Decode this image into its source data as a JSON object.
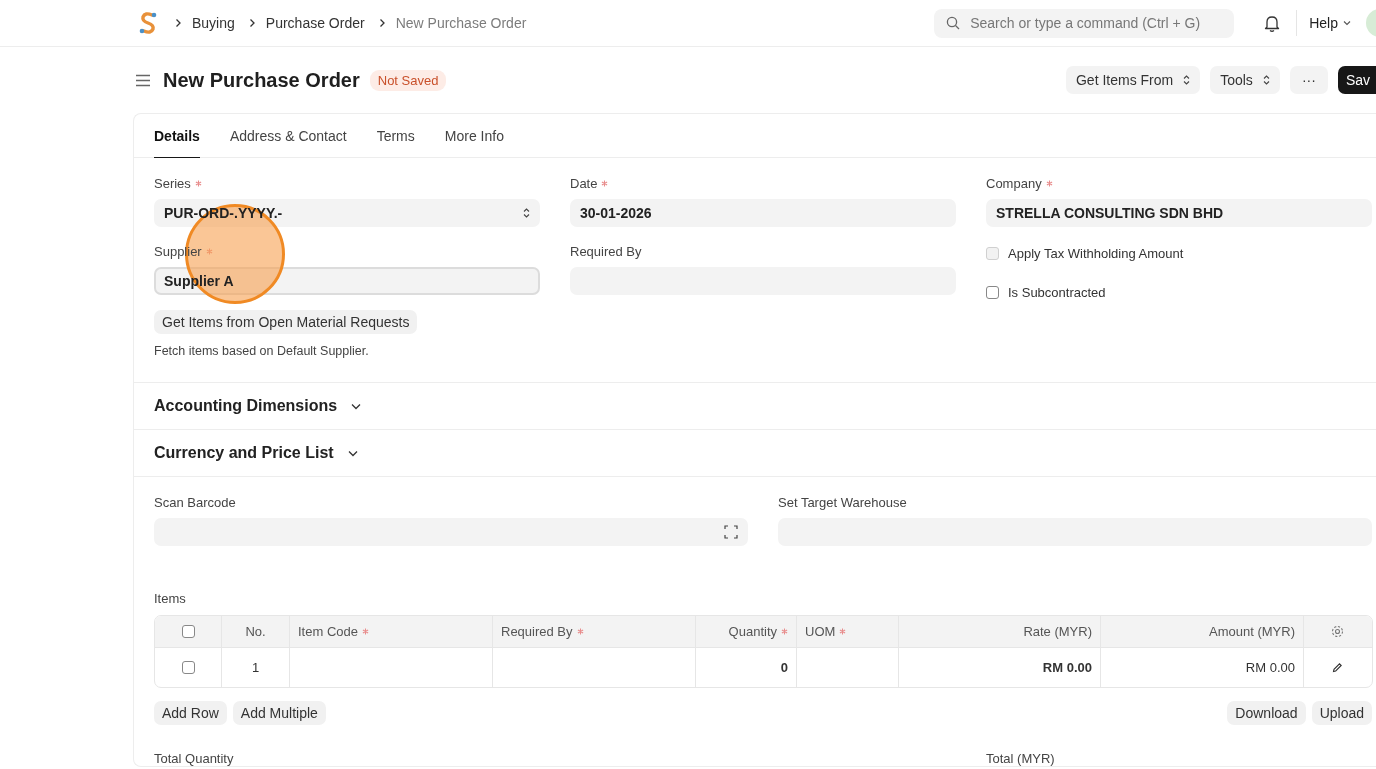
{
  "breadcrumbs": [
    {
      "label": "Buying",
      "current": false
    },
    {
      "label": "Purchase Order",
      "current": false
    },
    {
      "label": "New Purchase Order",
      "current": true
    }
  ],
  "search": {
    "placeholder": "Search or type a command (Ctrl + G)"
  },
  "help": "Help",
  "title": "New Purchase Order",
  "status": "Not Saved",
  "actions": [
    {
      "kind": "dropdown",
      "label": "Get Items From"
    },
    {
      "kind": "dropdown",
      "label": "Tools"
    },
    {
      "kind": "plain",
      "label": "···"
    },
    {
      "kind": "primary",
      "label": "Sav"
    }
  ],
  "tabs": [
    {
      "label": "Details",
      "selected": true
    },
    {
      "label": "Address & Contact",
      "selected": false
    },
    {
      "label": "Terms",
      "selected": false
    },
    {
      "label": "More Info",
      "selected": false
    }
  ],
  "columns": [
    [
      {
        "kind": "select",
        "label": "Series",
        "required": true,
        "value": "PUR-ORD-.YYYY.-",
        "focused": false
      },
      {
        "kind": "link",
        "label": "Supplier",
        "required": true,
        "value": "Supplier A",
        "focused": true
      },
      {
        "kind": "button",
        "label": "Get Items from Open Material Requests"
      },
      {
        "kind": "help",
        "label": "Fetch items based on Default Supplier."
      }
    ],
    [
      {
        "kind": "date",
        "label": "Date",
        "required": true,
        "value": "30-01-2026",
        "focused": false
      },
      {
        "kind": "date",
        "label": "Required By",
        "required": false,
        "focused": false
      }
    ],
    [
      {
        "kind": "data",
        "label": "Company",
        "required": true,
        "value": "STRELLA CONSULTING SDN BHD",
        "focused": false
      },
      {
        "kind": "check",
        "label": "Apply Tax Withholding Amount",
        "checked": false,
        "disabled": true
      },
      {
        "kind": "check",
        "label": "Is Subcontracted",
        "checked": false,
        "disabled": false
      }
    ]
  ],
  "sections": [
    {
      "title": "Accounting Dimensions",
      "expanded": false
    },
    {
      "title": "Currency and Price List",
      "expanded": false
    }
  ],
  "scan_fields": [
    {
      "kind": "barcode",
      "label": "Scan Barcode"
    },
    {
      "kind": "link",
      "label": "Set Target Warehouse"
    }
  ],
  "items": {
    "label": "Items",
    "all_selected": false,
    "columns": [
      {
        "label": "No.",
        "required": false
      },
      {
        "label": "Item Code",
        "required": true
      },
      {
        "label": "Required By",
        "required": true
      },
      {
        "label": "Quantity",
        "required": true
      },
      {
        "label": "UOM",
        "required": true
      },
      {
        "label": "Rate (MYR)",
        "required": false
      },
      {
        "label": "Amount (MYR)",
        "required": false
      }
    ],
    "rows": [
      {
        "selected": false,
        "no": "1",
        "quantity": "0",
        "rate": "RM 0.00",
        "amount": "RM 0.00"
      }
    ],
    "left_buttons": [
      "Add Row",
      "Add Multiple"
    ],
    "right_buttons": [
      "Download",
      "Upload"
    ]
  },
  "totals": [
    "Total Quantity",
    "Total (MYR)"
  ]
}
